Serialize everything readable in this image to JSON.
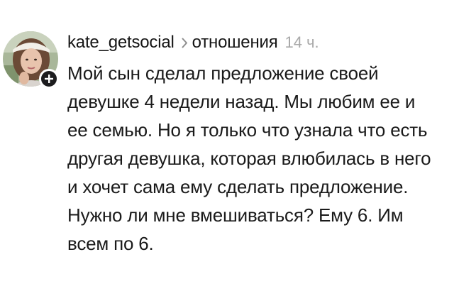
{
  "post": {
    "username": "kate_getsocial",
    "topic": "отношения",
    "time": "14 ч.",
    "text": "Мой сын сделал предложение своей девушке 4 недели назад. Мы любим ее и ее семью. Но я только что узнала что есть другая девушка, которая влюбилась в него и хочет сама ему сделать предложение. Нужно ли мне вмешиваться? Ему 6. Им всем по 6."
  },
  "icons": {
    "follow": "plus-icon",
    "topic_separator": "chevron-right-icon"
  },
  "colors": {
    "text": "#1a1a1a",
    "time": "#a9a9a9",
    "badge": "#1c1c1e"
  }
}
